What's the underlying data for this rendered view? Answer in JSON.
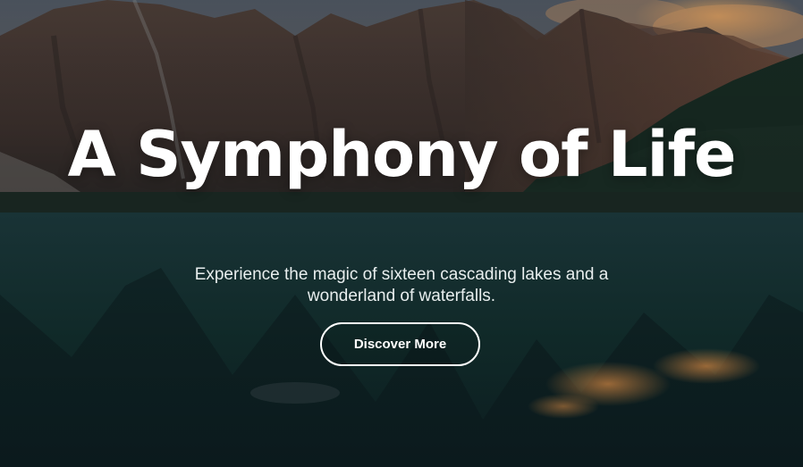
{
  "hero": {
    "title": "A Symphony of Life",
    "subtitle": "Experience the magic of sixteen cascading lakes and a wonderland of waterfalls.",
    "cta_label": "Discover More",
    "background": "mountain-lake-landscape",
    "colors": {
      "title_text": "#ffffff",
      "button_border": "#ffffff",
      "water": "#0f2a2e",
      "sunset_glow": "#d08a4a"
    }
  }
}
